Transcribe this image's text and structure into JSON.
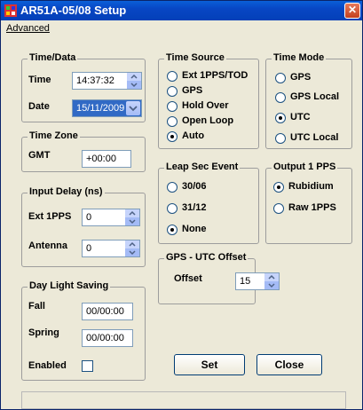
{
  "window": {
    "title": "AR51A-05/08 Setup",
    "close_glyph": "✕"
  },
  "menu": {
    "advanced": "Advanced"
  },
  "time_data": {
    "legend": "Time/Data",
    "time_label": "Time",
    "time_value": "14:37:32",
    "date_label": "Date",
    "date_value": "15/11/2009"
  },
  "time_zone": {
    "legend": "Time Zone",
    "gmt_label": "GMT",
    "gmt_value": "+00:00"
  },
  "input_delay": {
    "legend": "Input Delay (ns)",
    "ext_label": "Ext 1PPS",
    "ext_value": "0",
    "antenna_label": "Antenna",
    "antenna_value": "0"
  },
  "daylight": {
    "legend": "Day Light Saving",
    "fall_label": "Fall",
    "fall_value": "00/00:00",
    "spring_label": "Spring",
    "spring_value": "00/00:00",
    "enabled_label": "Enabled",
    "enabled_checked": false
  },
  "time_source": {
    "legend": "Time Source",
    "options": [
      "Ext 1PPS/TOD",
      "GPS",
      "Hold Over",
      "Open Loop",
      "Auto"
    ],
    "selected": "Auto"
  },
  "time_mode": {
    "legend": "Time Mode",
    "options": [
      "GPS",
      "GPS Local",
      "UTC",
      "UTC Local"
    ],
    "selected": "UTC"
  },
  "leap_sec": {
    "legend": "Leap Sec Event",
    "options": [
      "30/06",
      "31/12",
      "None"
    ],
    "selected": "None"
  },
  "output_pps": {
    "legend": "Output 1 PPS",
    "options": [
      "Rubidium",
      "Raw 1PPS"
    ],
    "selected": "Rubidium"
  },
  "gps_utc": {
    "legend": "GPS - UTC Offset",
    "offset_label": "Offset",
    "offset_value": "15"
  },
  "buttons": {
    "set": "Set",
    "close": "Close"
  },
  "colors": {
    "titlebar": "#0846c4",
    "face": "#ece9d8",
    "field_border": "#7f9db9"
  }
}
